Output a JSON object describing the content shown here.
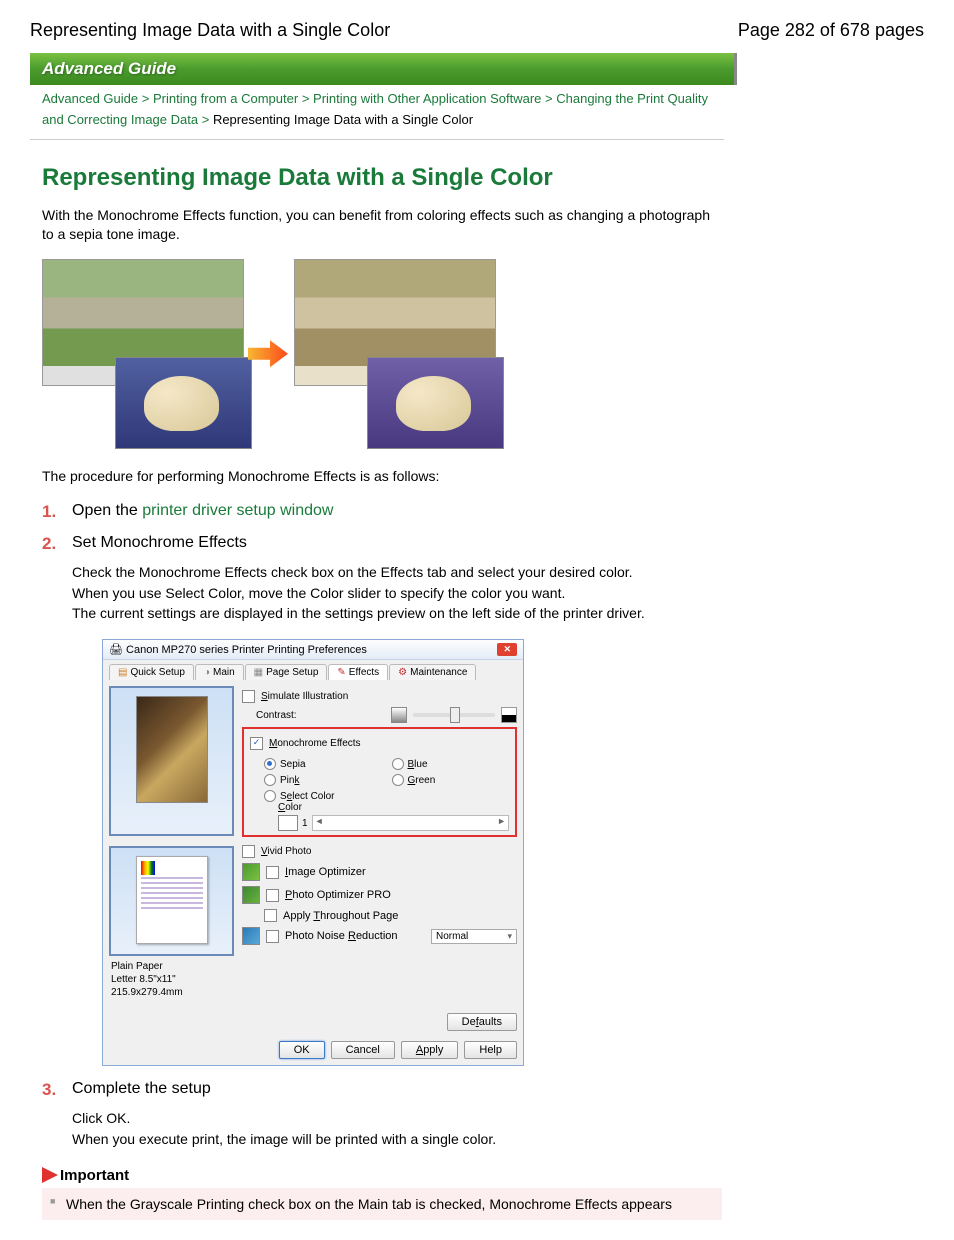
{
  "header": {
    "title": "Representing Image Data with a Single Color",
    "page": "Page 282 of 678 pages"
  },
  "guide_bar": "Advanced Guide",
  "breadcrumb": {
    "l1": "Advanced Guide",
    "l2": "Printing from a Computer",
    "l3": "Printing with Other Application Software",
    "l4": "Changing the Print Quality and Correcting Image Data",
    "cur": "Representing Image Data with a Single Color",
    "sep": ">"
  },
  "h1": "Representing Image Data with a Single Color",
  "intro": "With the Monochrome Effects function, you can benefit from coloring effects such as changing a photograph to a sepia tone image.",
  "proc_intro": "The procedure for performing Monochrome Effects is as follows:",
  "steps": {
    "s1_num": "1.",
    "s1_a": "Open the ",
    "s1_link": "printer driver setup window",
    "s2_num": "2.",
    "s2_title": "Set Monochrome Effects",
    "s2_body": "Check the Monochrome Effects check box on the Effects tab and select your desired color.\nWhen you use Select Color, move the Color slider to specify the color you want.\nThe current settings are displayed in the settings preview on the left side of the printer driver.",
    "s3_num": "3.",
    "s3_title": "Complete the setup",
    "s3_body": "Click OK.\nWhen you execute print, the image will be printed with a single color."
  },
  "dialog": {
    "title": "Canon MP270 series Printer Printing Preferences",
    "tabs": {
      "quick": "Quick Setup",
      "main": "Main",
      "page": "Page Setup",
      "effects": "Effects",
      "maint": "Maintenance"
    },
    "sim": "Simulate Illustration",
    "contrast": "Contrast:",
    "mono": {
      "label": "Monochrome Effects",
      "sepia": "Sepia",
      "blue": "Blue",
      "pink": "Pink",
      "green": "Green",
      "select": "Select Color",
      "color": "Color",
      "val": "1"
    },
    "vivid": "Vivid Photo",
    "imgopt": "Image Optimizer",
    "pro": "Photo Optimizer PRO",
    "apply": "Apply Throughout Page",
    "noise": "Photo Noise Reduction",
    "noise_val": "Normal",
    "paper": {
      "type": "Plain Paper",
      "size": "Letter 8.5\"x11\" 215.9x279.4mm"
    },
    "defaults": "Defaults",
    "btns": {
      "ok": "OK",
      "cancel": "Cancel",
      "apply": "Apply",
      "help": "Help"
    }
  },
  "important": {
    "label": "Important",
    "text": "When the Grayscale Printing check box on the Main tab is checked, Monochrome Effects appears"
  }
}
